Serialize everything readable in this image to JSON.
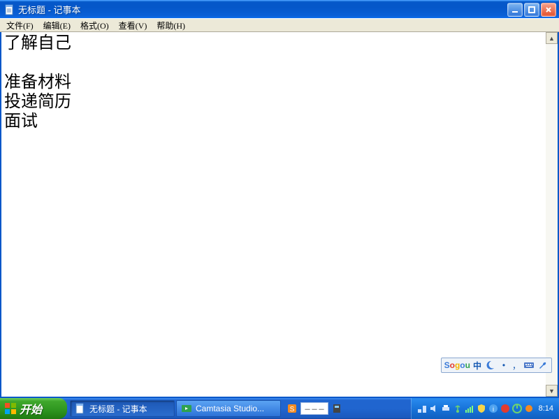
{
  "window": {
    "title": "无标题 - 记事本"
  },
  "menu": {
    "file": "文件(F)",
    "edit": "编辑(E)",
    "format": "格式(O)",
    "view": "查看(V)",
    "help": "帮助(H)"
  },
  "editor": {
    "content": "了解自己\n\n准备材料\n投递简历\n面试"
  },
  "ime": {
    "logo_name": "Sogou",
    "mode": "中"
  },
  "taskbar": {
    "start_label": "开始",
    "tasks": [
      {
        "label": "无标题 - 记事本",
        "active": true
      },
      {
        "label": "Camtasia Studio...",
        "active": false
      }
    ],
    "quicklaunch_placeholder": "－－－",
    "clock": "8:14"
  }
}
